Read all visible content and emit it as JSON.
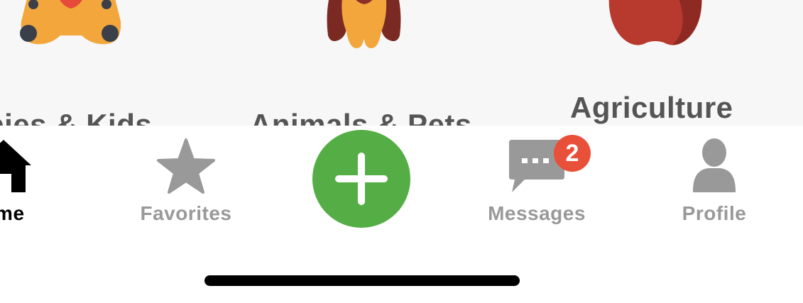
{
  "categories": [
    {
      "label": "bies & Kids",
      "icon": "teddy-bear-icon"
    },
    {
      "label": "Animals & Pets",
      "icon": "dog-icon"
    },
    {
      "label": "Agriculture",
      "icon": "apple-icon"
    }
  ],
  "tabbar": {
    "tabs": [
      {
        "label": "ome",
        "icon": "home-icon",
        "active": true
      },
      {
        "label": "Favorites",
        "icon": "star-icon",
        "active": false
      },
      {
        "label": "Messages",
        "icon": "chat-bubble-icon",
        "badge": "2",
        "active": false
      },
      {
        "label": "Profile",
        "icon": "person-icon",
        "active": false
      }
    ],
    "post_icon": "plus-icon"
  },
  "colors": {
    "post_button": "#55ae45",
    "badge": "#e8503a",
    "inactive_tab": "#999999",
    "active_tab": "#000000",
    "category_label": "#555555"
  }
}
